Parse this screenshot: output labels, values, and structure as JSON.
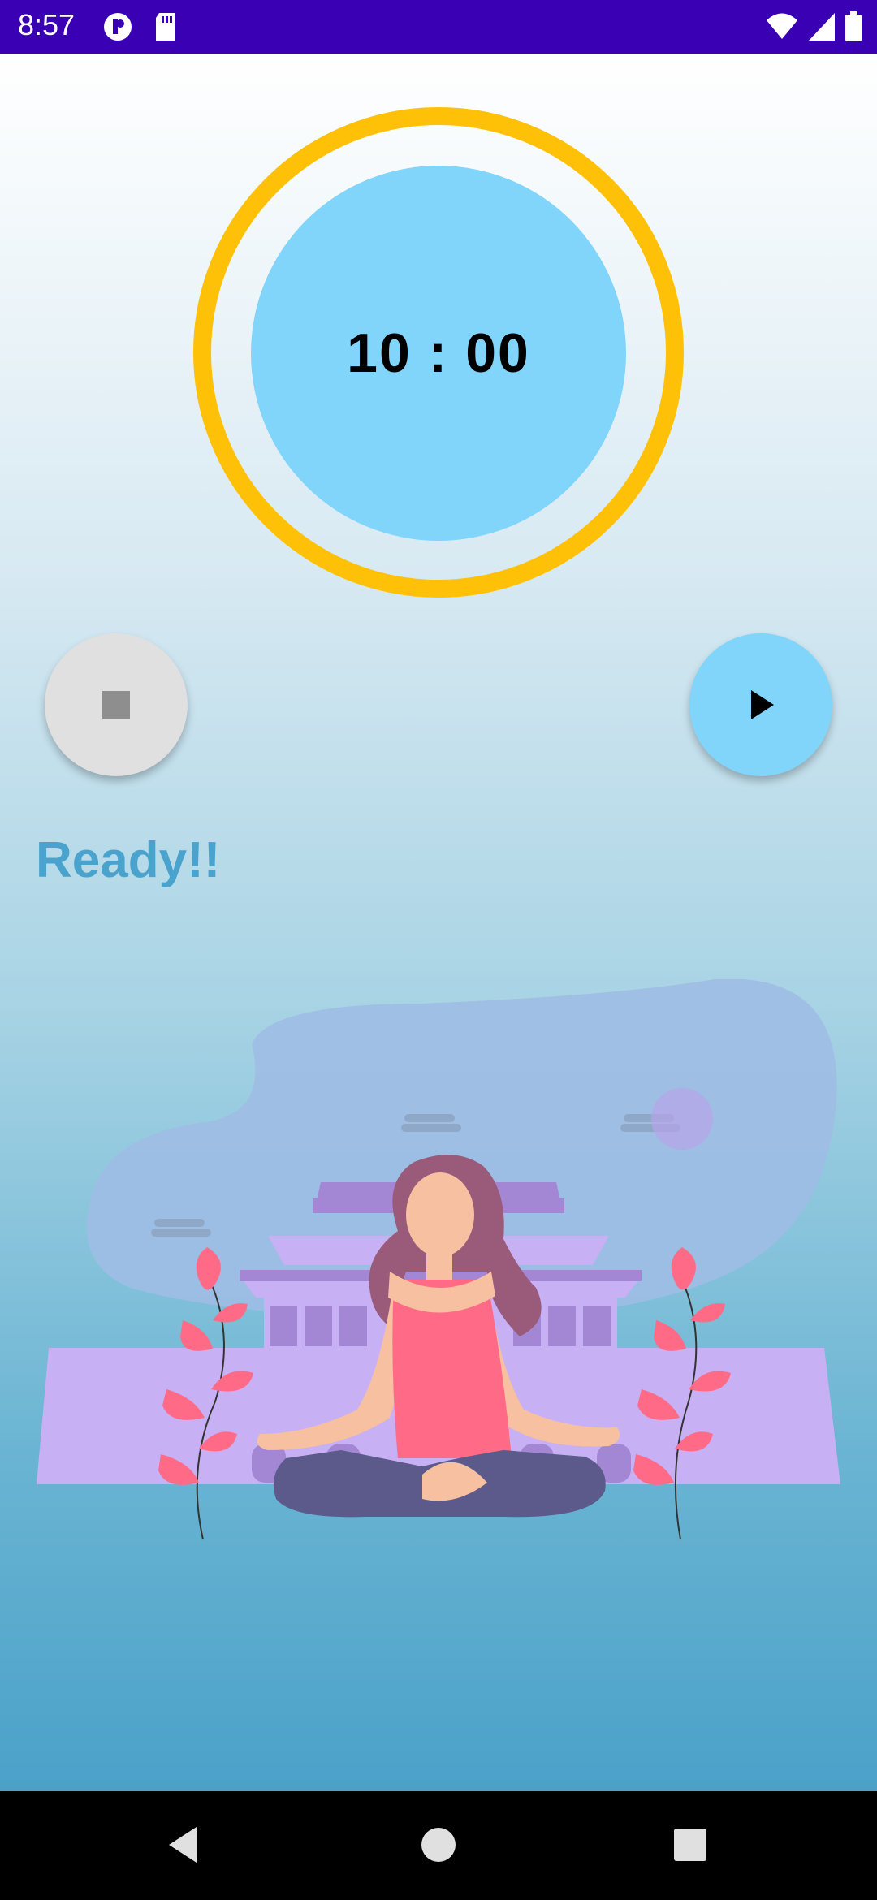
{
  "status_bar": {
    "time": "8:57",
    "icons": [
      "app-notification-icon",
      "sd-card-icon",
      "wifi-icon",
      "signal-icon",
      "battery-icon"
    ],
    "color": "#3a00b4"
  },
  "timer": {
    "display": "10 : 00",
    "ring_color": "#ffc107",
    "circle_color": "#81d4fa"
  },
  "controls": {
    "stop_icon": "stop-icon",
    "play_icon": "play-icon"
  },
  "status": {
    "text": "Ready!!",
    "color": "#4aa3cd"
  },
  "illustration": {
    "subject": "meditation-illustration"
  },
  "nav_bar": {
    "icons": [
      "back-icon",
      "home-icon",
      "recents-icon"
    ]
  }
}
